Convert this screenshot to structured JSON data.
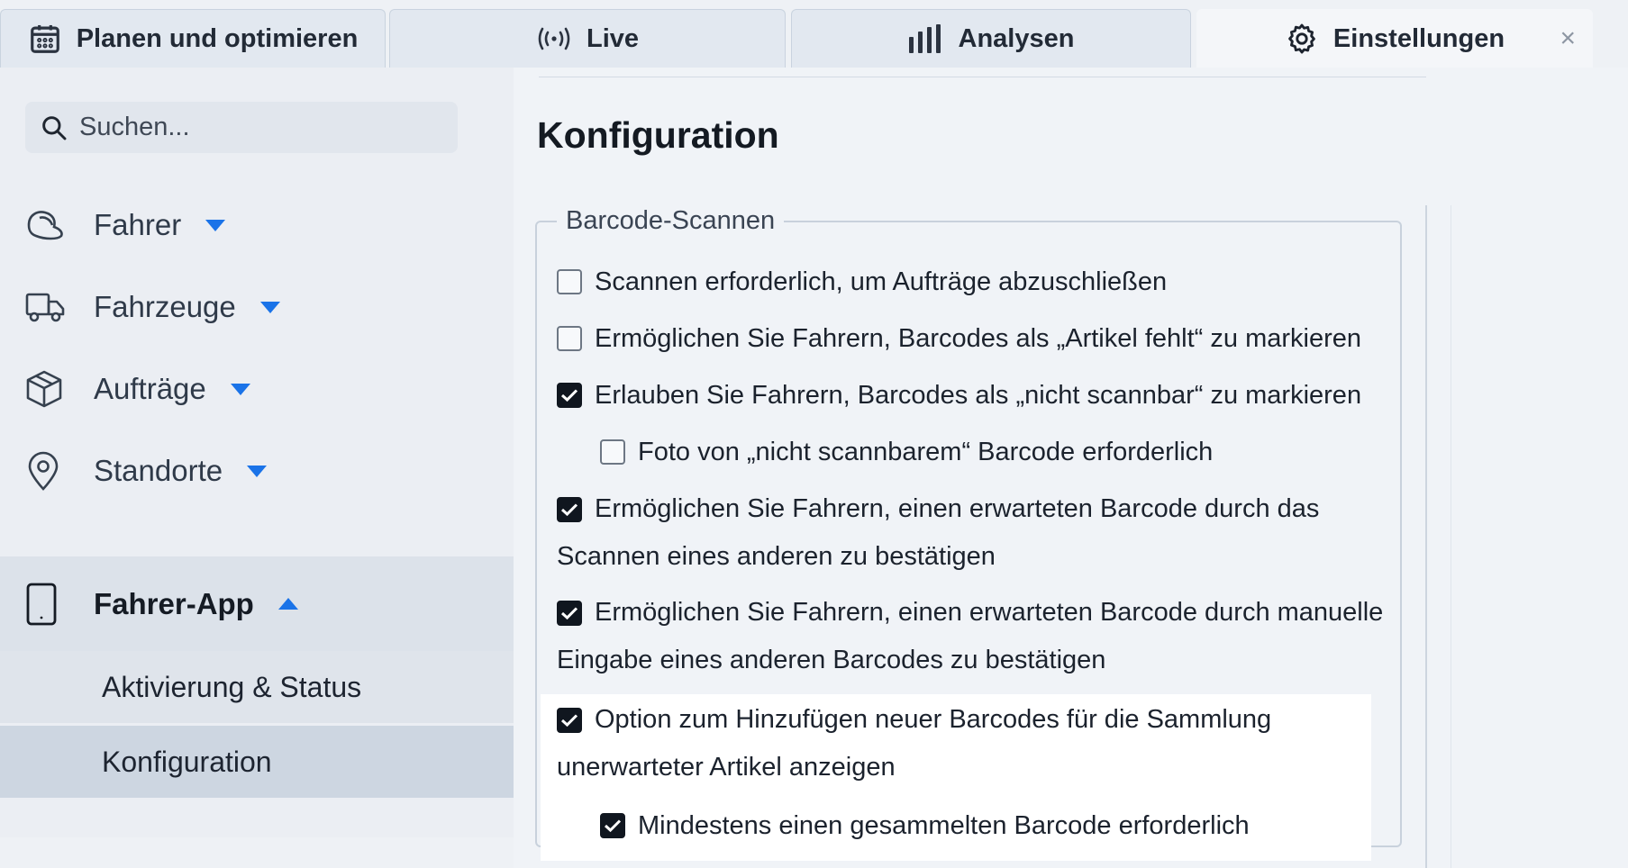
{
  "tabs": [
    {
      "label": "Planen und optimieren",
      "icon": "calendar-icon"
    },
    {
      "label": "Live",
      "icon": "broadcast-icon"
    },
    {
      "label": "Analysen",
      "icon": "bar-chart-icon"
    },
    {
      "label": "Einstellungen",
      "icon": "gear-icon",
      "active": true
    }
  ],
  "tab_close": "×",
  "search": {
    "placeholder": "Suchen..."
  },
  "sidebar": {
    "items": [
      {
        "label": "Fahrer",
        "icon": "driver-icon"
      },
      {
        "label": "Fahrzeuge",
        "icon": "truck-icon"
      },
      {
        "label": "Aufträge",
        "icon": "package-icon"
      },
      {
        "label": "Standorte",
        "icon": "location-pin-icon"
      },
      {
        "label": "Fahrer-App",
        "icon": "phone-icon",
        "expanded": true
      }
    ],
    "sub_items": [
      {
        "label": "Aktivierung & Status"
      },
      {
        "label": "Konfiguration",
        "selected": true
      }
    ]
  },
  "main": {
    "title": "Konfiguration",
    "group_title": "Barcode-Scannen",
    "options": [
      {
        "label": "Scannen erforderlich, um Aufträge abzuschließen",
        "checked": false
      },
      {
        "label": "Ermöglichen Sie Fahrern, Barcodes als „Artikel fehlt“ zu markieren",
        "checked": false
      },
      {
        "label": "Erlauben Sie Fahrern, Barcodes als „nicht scannbar“ zu markieren",
        "checked": true
      },
      {
        "label": "Foto von „nicht scannbarem“ Barcode erforderlich",
        "checked": false
      },
      {
        "label": "Ermöglichen Sie Fahrern, einen erwarteten Barcode durch das Scannen eines anderen zu bestätigen",
        "checked": true
      },
      {
        "label": "Ermöglichen Sie Fahrern, einen erwarteten Barcode durch manuelle Eingabe eines anderen Barcodes zu bestätigen",
        "checked": true
      },
      {
        "label": "Option zum Hinzufügen neuer Barcodes für die Sammlung unerwarteter Artikel anzeigen",
        "checked": true
      },
      {
        "label": "Mindestens einen gesammelten Barcode erforderlich",
        "checked": true
      }
    ]
  },
  "colors": {
    "accent": "#1a73e8",
    "checkbox_checked": "#10161f"
  }
}
